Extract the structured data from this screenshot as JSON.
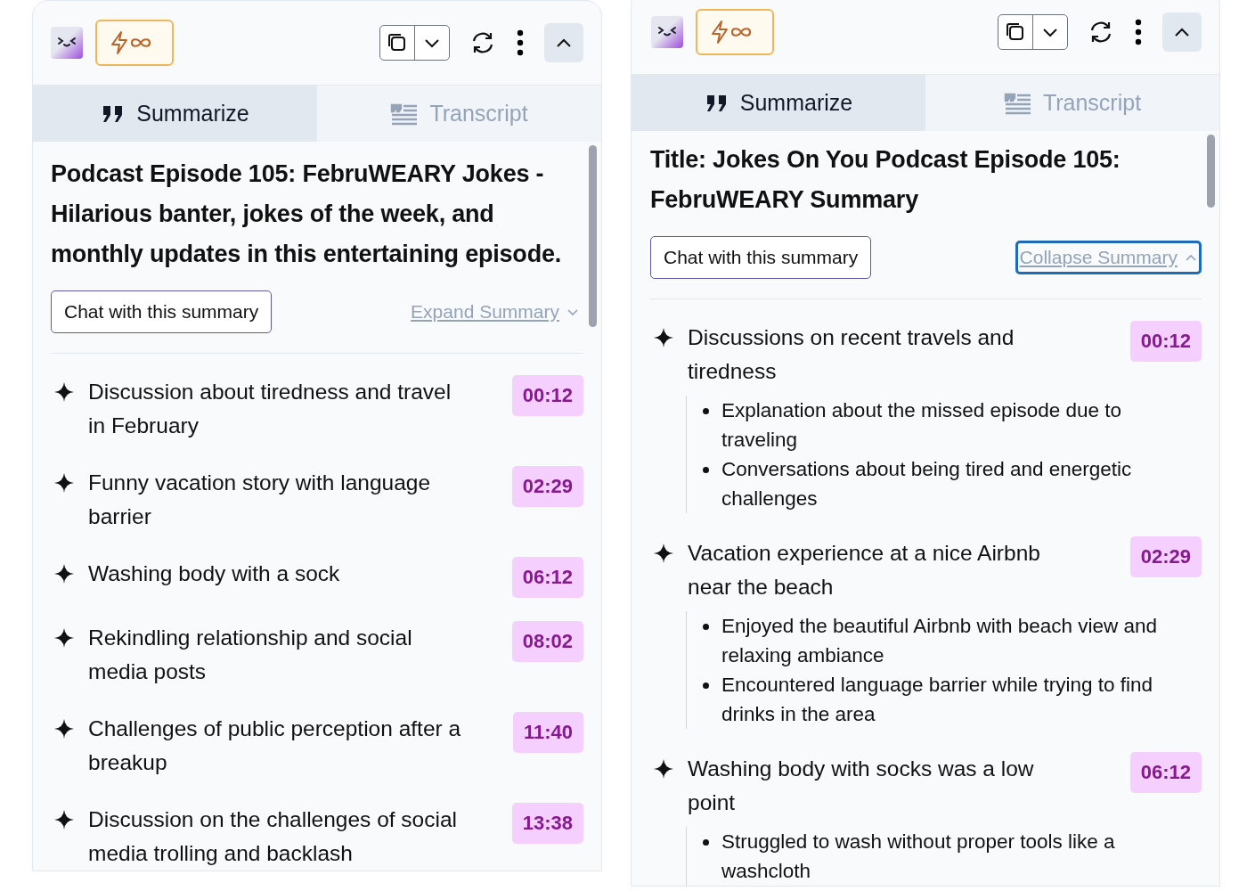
{
  "panels": [
    {
      "tabs": [
        {
          "label": "Summarize",
          "kind": "summarize",
          "selected": true
        },
        {
          "label": "Transcript",
          "kind": "transcript",
          "selected": false
        }
      ],
      "title": "Podcast Episode 105: FebruWEARY Jokes - Hilarious banter, jokes of the week, and monthly updates in this entertaining episode.",
      "chat_button": "Chat with this summary",
      "toggle": {
        "label": "Expand Summary",
        "expanded": false,
        "focused": false
      },
      "items": [
        {
          "text": "Discussion about tiredness and travel in February",
          "time": "00:12"
        },
        {
          "text": "Funny vacation story with language barrier",
          "time": "02:29"
        },
        {
          "text": "Washing body with a sock",
          "time": "06:12"
        },
        {
          "text": "Rekindling relationship and social media posts",
          "time": "08:02"
        },
        {
          "text": "Challenges of public perception after a breakup",
          "time": "11:40"
        },
        {
          "text": "Discussion on the challenges of social media trolling and backlash",
          "time": "13:38"
        }
      ]
    },
    {
      "tabs": [
        {
          "label": "Summarize",
          "kind": "summarize",
          "selected": true
        },
        {
          "label": "Transcript",
          "kind": "transcript",
          "selected": false
        }
      ],
      "title": "Title: Jokes On You Podcast Episode 105: FebruWEARY Summary",
      "chat_button": "Chat with this summary",
      "toggle": {
        "label": "Collapse Summary",
        "expanded": true,
        "focused": true
      },
      "items": [
        {
          "text": "Discussions on recent travels and tiredness",
          "time": "00:12",
          "children": [
            {
              "text": "Explanation about the missed episode due to traveling"
            },
            {
              "text": "Conversations about being tired and energetic challenges"
            }
          ]
        },
        {
          "text": "Vacation experience at a nice Airbnb near the beach",
          "time": "02:29",
          "children": [
            {
              "text": "Enjoyed the beautiful Airbnb with beach view and relaxing ambiance"
            },
            {
              "text": "Encountered language barrier while trying to find drinks in the area"
            }
          ]
        },
        {
          "text": "Washing body with socks was a low point",
          "time": "06:12",
          "children": [
            {
              "text": "Struggled to wash without proper tools like a washcloth"
            }
          ]
        }
      ]
    }
  ]
}
